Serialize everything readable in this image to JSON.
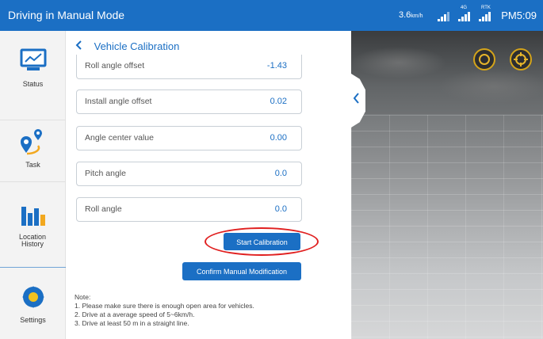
{
  "topbar": {
    "title": "Driving in Manual Mode",
    "speed_value": "3.6",
    "speed_unit": "km/h",
    "signal_4g_label": "4G",
    "signal_rtk_label": "RTK",
    "time": "PM5:09"
  },
  "sidebar": {
    "items": [
      {
        "label": "Status",
        "icon": "monitor-chart-icon"
      },
      {
        "label": "Task",
        "icon": "route-pin-icon"
      },
      {
        "label": "Location History",
        "icon": "bar-chart-icon"
      },
      {
        "label": "Settings",
        "icon": "gear-icon"
      }
    ]
  },
  "panel": {
    "back_icon": "chevron-left-icon",
    "title": "Vehicle Calibration",
    "fields": [
      {
        "label": "Roll angle offset",
        "value": "-1.43"
      },
      {
        "label": "Install angle offset",
        "value": "0.02"
      },
      {
        "label": "Angle center value",
        "value": "0.00"
      },
      {
        "label": "Pitch angle",
        "value": "0.0"
      },
      {
        "label": "Roll angle",
        "value": "0.0"
      }
    ],
    "start_button": "Start Calibration",
    "confirm_button": "Confirm Manual Modification",
    "note_title": "Note:",
    "notes": [
      "1. Please make sure there is enough open area for vehicles.",
      "2. Drive at a average speed of 5~6km/h.",
      "3. Drive at least 50 m in a straight line."
    ]
  },
  "map": {
    "buttons": [
      "camera-icon",
      "crosshair-icon"
    ],
    "collapse_icon": "chevron-left-icon"
  },
  "colors": {
    "accent": "#1b6fc4",
    "highlight_ring": "#e02020",
    "map_button_ring": "#d4a41a"
  }
}
